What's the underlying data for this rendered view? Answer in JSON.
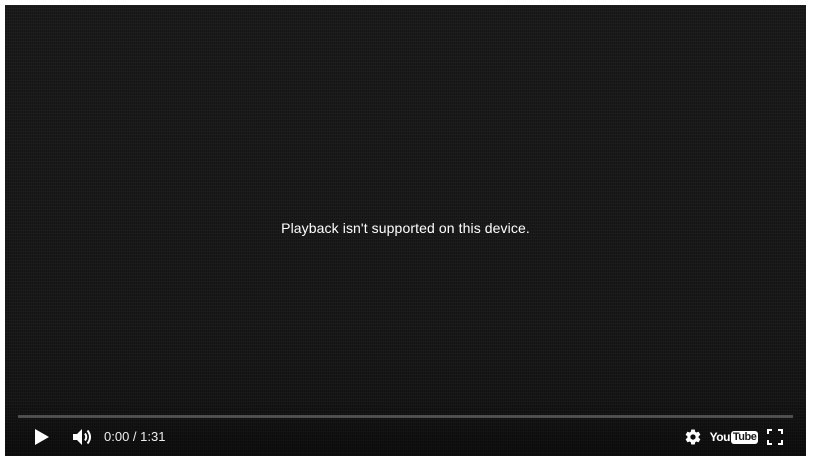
{
  "player": {
    "error_message": "Playback isn't supported on this device.",
    "progress_fraction": 0,
    "time": {
      "current": "0:00",
      "separator": " / ",
      "duration": "1:31"
    },
    "logo": {
      "you": "You",
      "tube": "Tube"
    },
    "icons": {
      "play": "play-icon",
      "volume": "volume-icon",
      "settings": "gear-icon",
      "fullscreen": "fullscreen-icon"
    },
    "colors": {
      "background": "#151515",
      "progress_track": "#444444",
      "text": "#ffffff"
    }
  }
}
